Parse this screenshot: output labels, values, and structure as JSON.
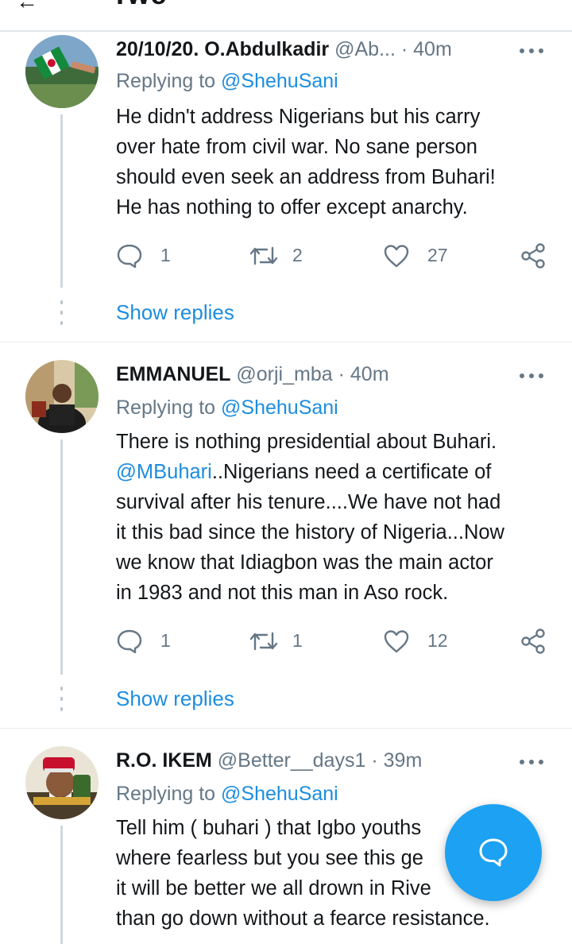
{
  "header_partial": {
    "title_fragment": "Twe",
    "back_glyph": "←"
  },
  "icons": {
    "reply": "comment-bubble-icon",
    "retweet": "retweet-icon",
    "like": "heart-icon",
    "share": "share-icon",
    "more": "more-dots-icon",
    "compose_reply": "reply-compose-icon"
  },
  "colors": {
    "link": "#1d8ddf",
    "fab": "#1da1f2",
    "muted": "#657786",
    "text": "#14171a"
  },
  "tweets": [
    {
      "name": "20/10/20. O.Abdulkadir",
      "handle": "@Ab...",
      "sep": "·",
      "time": "40m",
      "replying_prefix": "Replying to ",
      "replying_to": "@ShehuSani",
      "lines": [
        "He didn't address Nigerians but his carry",
        "over hate from civil war. No sane person",
        "should even seek an address from Buhari!",
        "He has nothing to offer except anarchy."
      ],
      "replies": "1",
      "retweets": "2",
      "likes": "27",
      "show_replies": "Show replies"
    },
    {
      "name": "EMMANUEL",
      "handle": "@orji_mba",
      "sep": "·",
      "time": "40m",
      "replying_prefix": "Replying to ",
      "replying_to": "@ShehuSani",
      "line1": "There is nothing presidential about Buhari.",
      "line2_mention": "@MBuhari",
      "line2_rest": "..Nigerians need a certificate of",
      "line3": "survival after his tenure....We have not had",
      "line4": "it this bad since the history of Nigeria...Now",
      "line5": "we know that Idiagbon was the main actor",
      "line6": "in 1983 and not this man in Aso rock.",
      "replies": "1",
      "retweets": "1",
      "likes": "12",
      "show_replies": "Show replies"
    },
    {
      "name": "R.O. IKEM",
      "handle": "@Better__days1",
      "sep": "·",
      "time": "39m",
      "replying_prefix": "Replying to ",
      "replying_to": "@ShehuSani",
      "lines": [
        "Tell him ( buhari ) that Igbo youths",
        "where fearless but you see this ge",
        "it will be better we all drown in Rive",
        "than go down without a fearce resistance."
      ]
    }
  ]
}
